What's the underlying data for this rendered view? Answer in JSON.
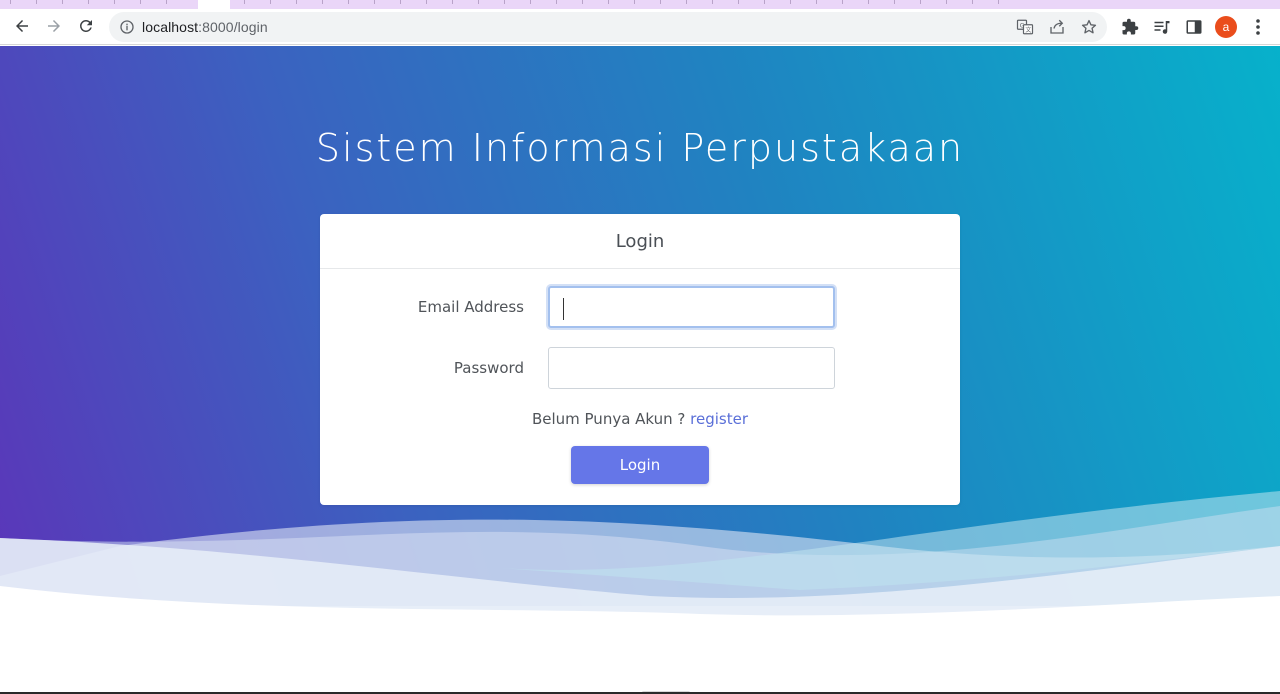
{
  "browser": {
    "url_host": "localhost",
    "url_path": ":8000/login",
    "profile_initial": "a",
    "colors": {
      "avatar": "#ea4d1c",
      "tabstrip": "#ead6f8"
    },
    "icons": [
      "back-arrow-icon",
      "forward-arrow-icon",
      "reload-icon",
      "site-info-icon",
      "translate-icon",
      "share-icon",
      "bookmark-star-icon",
      "extensions-puzzle-icon",
      "reading-list-icon",
      "side-panel-icon",
      "more-menu-icon"
    ]
  },
  "page": {
    "site_title": "Sistem Informasi Perpustakaan",
    "colors": {
      "gradient_start": "#5b36b9",
      "gradient_end": "#07b1cb",
      "button": "#6576e8",
      "link": "#5a6fd8"
    }
  },
  "login_card": {
    "header": "Login",
    "email_label": "Email Address",
    "email_value": "",
    "password_label": "Password",
    "password_value": "",
    "register_prompt": "Belum Punya Akun ?",
    "register_link": "register",
    "submit_label": "Login"
  }
}
